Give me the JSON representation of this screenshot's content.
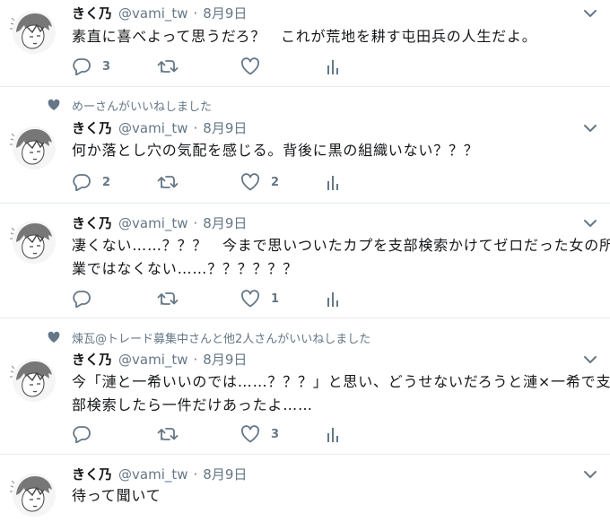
{
  "tweets": [
    {
      "name": "きく乃",
      "handle": "@vami_tw",
      "separator": "·",
      "date": "8月9日",
      "context": "",
      "lines": [
        "素直に喜べよって思うだろ？　これが荒地を耕す屯田兵の人生だよ。"
      ],
      "reply_count": "3",
      "retweet_count": "",
      "like_count": ""
    },
    {
      "name": "きく乃",
      "handle": "@vami_tw",
      "separator": "·",
      "date": "8月9日",
      "context": "めーさんがいいねしました",
      "lines": [
        "何か落とし穴の気配を感じる。背後に黒の組織いない？？？"
      ],
      "reply_count": "2",
      "retweet_count": "",
      "like_count": "2"
    },
    {
      "name": "きく乃",
      "handle": "@vami_tw",
      "separator": "·",
      "date": "8月9日",
      "context": "",
      "lines": [
        "凄くない……？？？　今まで思いついたカプを支部検索かけてゼロだった女の所",
        "業ではなくない……？？？？？？"
      ],
      "reply_count": "",
      "retweet_count": "",
      "like_count": "1"
    },
    {
      "name": "きく乃",
      "handle": "@vami_tw",
      "separator": "·",
      "date": "8月9日",
      "context": "煉瓦@トレード募集中さんと他2人さんがいいねしました",
      "lines": [
        "今「漣と一希いいのでは……？？？」と思い、どうせないだろうと漣×一希で支",
        "部検索したら一件だけあったよ……"
      ],
      "reply_count": "",
      "retweet_count": "",
      "like_count": "3"
    },
    {
      "name": "きく乃",
      "handle": "@vami_tw",
      "separator": "·",
      "date": "8月9日",
      "context": "",
      "lines": [
        "待って聞いて"
      ],
      "reply_count": "",
      "retweet_count": "",
      "like_count": ""
    }
  ],
  "icons": {
    "reply": "reply-icon",
    "retweet": "retweet-icon",
    "like": "heart-icon",
    "analytics": "analytics-icon",
    "menu": "chevron-down-icon",
    "liked_context": "heart-filled-icon"
  },
  "colors": {
    "text": "#14171a",
    "secondary": "#657786",
    "divider": "#e6ecf0"
  }
}
